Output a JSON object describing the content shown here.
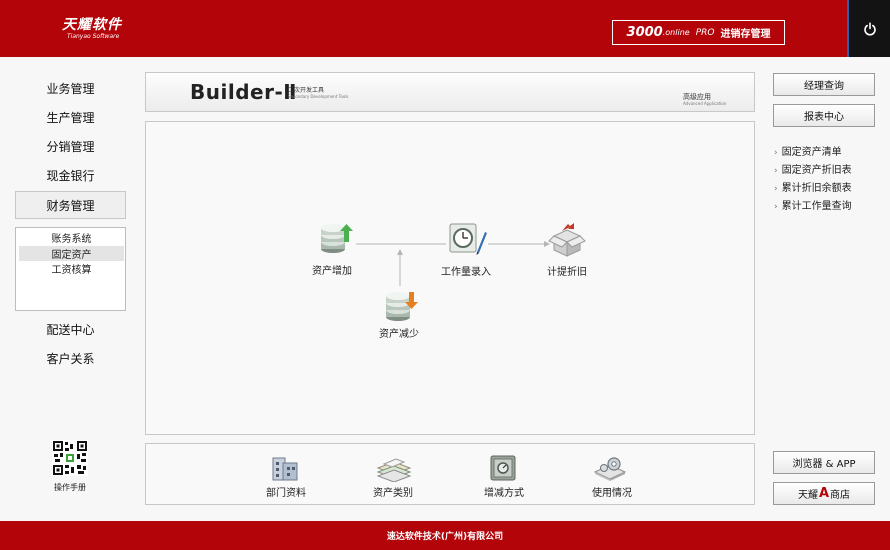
{
  "header": {
    "logo_text": "天耀软件",
    "logo_subtext": "Tianyao Software",
    "banner_number": "3000",
    "banner_online": ".online",
    "banner_pro": "PRO",
    "banner_name": "进销存管理"
  },
  "sidebar": {
    "items": [
      "业务管理",
      "生产管理",
      "分销管理",
      "现金银行",
      "财务管理"
    ],
    "submenu": [
      "账务系统",
      "固定资产",
      "工资核算"
    ],
    "items_after": [
      "配送中心",
      "客户关系"
    ],
    "qr_label": "操作手册"
  },
  "top_panel": {
    "title": "Builder-Ⅱ",
    "title_cn": "二次开发工具",
    "title_en": "Secondary Development Tools",
    "advanced_cn": "高级应用",
    "advanced_en": "Advanced Application"
  },
  "flow": {
    "asset_add": "资产增加",
    "workload_entry": "工作量录入",
    "depreciation": "计提折旧",
    "asset_reduce": "资产减少"
  },
  "bottom_tools": [
    "部门资料",
    "资产类别",
    "增减方式",
    "使用情况"
  ],
  "right_panel": {
    "buttons": [
      "经理查询",
      "报表中心"
    ],
    "links": [
      "固定资产清单",
      "固定资产折旧表",
      "累计折旧余额表",
      "累计工作量查询"
    ],
    "browser_app": "浏览器 & APP",
    "shop_prefix": "天耀",
    "shop_letter": "A",
    "shop_suffix": "商店"
  },
  "footer": {
    "company": "速达软件技术(广州)有限公司"
  },
  "colors": {
    "brand_red": "#b3040a",
    "power_bg": "#131313",
    "power_border": "#2d5fa9"
  }
}
